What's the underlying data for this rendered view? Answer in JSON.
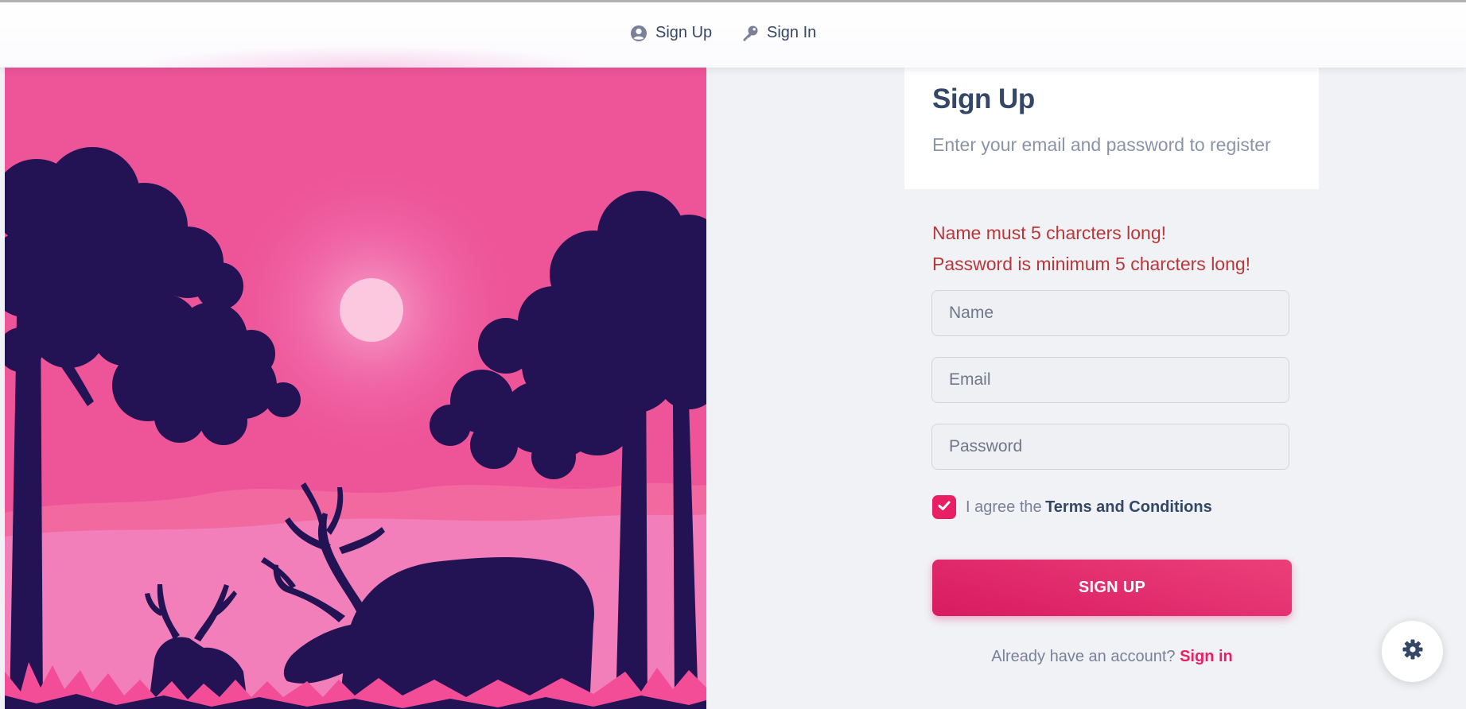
{
  "nav": {
    "links": [
      {
        "label": "Sign Up",
        "icon": "user-circle-icon"
      },
      {
        "label": "Sign In",
        "icon": "key-icon"
      }
    ]
  },
  "card": {
    "title": "Sign Up",
    "subtitle": "Enter your email and password to register"
  },
  "errors": [
    "Name must 5 charcters long!",
    "Password is minimum 5 charcters long!"
  ],
  "form": {
    "name_placeholder": "Name",
    "email_placeholder": "Email",
    "password_placeholder": "Password",
    "terms_prefix": "I agree the",
    "terms_link": "Terms and Conditions",
    "terms_checked": true,
    "submit_label": "SIGN UP"
  },
  "footer": {
    "text": "Already have an account?",
    "link": "Sign in"
  },
  "fab": {
    "icon": "gear-icon"
  },
  "colors": {
    "accent": "#e91e63",
    "hero_sky": "#ee5498",
    "silhouette": "#231354",
    "error": "#b6383b",
    "text_dark": "#344767"
  }
}
